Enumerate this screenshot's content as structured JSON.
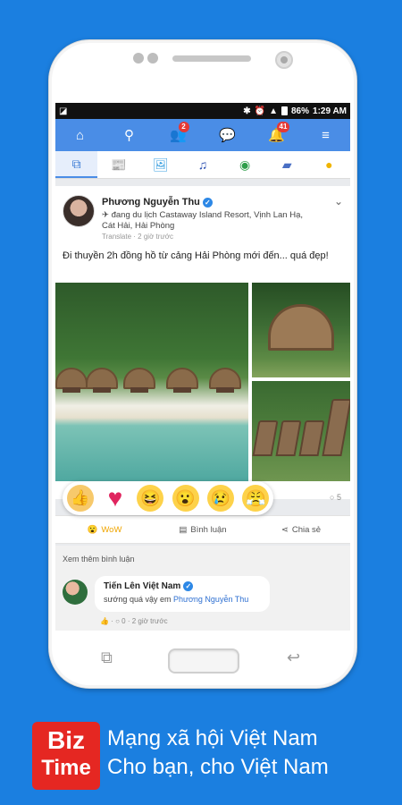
{
  "status_bar": {
    "battery": "86%",
    "time": "1:29 AM"
  },
  "navbar": {
    "items": [
      {
        "icon": "home-icon",
        "glyph": "⌂"
      },
      {
        "icon": "search-icon",
        "glyph": "⚲"
      },
      {
        "icon": "friends-icon",
        "glyph": "👥",
        "badge": "2"
      },
      {
        "icon": "chat-icon",
        "glyph": "💬"
      },
      {
        "icon": "notifications-icon",
        "glyph": "🔔",
        "badge": "41"
      },
      {
        "icon": "menu-icon",
        "glyph": "≡"
      }
    ]
  },
  "tabs": [
    {
      "icon": "feed-icon",
      "glyph": "⧉"
    },
    {
      "icon": "news-icon",
      "glyph": "📰"
    },
    {
      "icon": "photo-icon",
      "glyph": "🖼"
    },
    {
      "icon": "music-icon",
      "glyph": "♫"
    },
    {
      "icon": "video-icon",
      "glyph": "◉"
    },
    {
      "icon": "folder-icon",
      "glyph": "▰"
    },
    {
      "icon": "location-icon",
      "glyph": "●"
    }
  ],
  "post": {
    "author": "Phương Nguyễn Thu",
    "checkin": "✈ đang du lịch Castaway Island Resort, Vịnh Lan Hạ, Cát Hải, Hải Phòng",
    "translate": "Translate",
    "time": "2 giờ trước",
    "text": "Đi thuyền 2h đồng hồ từ cảng Hải Phòng mới đến... quá đẹp!",
    "comment_count": "5",
    "reactions": [
      "like",
      "love",
      "haha",
      "wow",
      "sad",
      "angry"
    ],
    "actions": {
      "wow": "WoW",
      "comment": "Bình luận",
      "share": "Chia sẻ"
    }
  },
  "comments": {
    "see_more": "Xem thêm bình luận",
    "items": [
      {
        "author": "Tiến Lên Việt Nam",
        "text": "sướng quá vậy em",
        "mention": "Phương Nguyễn Thu",
        "meta": "0 · 2 giờ trước"
      }
    ]
  },
  "branding": {
    "logo_line1": "Biz",
    "logo_line2": "Time",
    "tagline_line1": "Mạng xã hội Việt Nam",
    "tagline_line2": "Cho bạn, cho Việt Nam"
  }
}
